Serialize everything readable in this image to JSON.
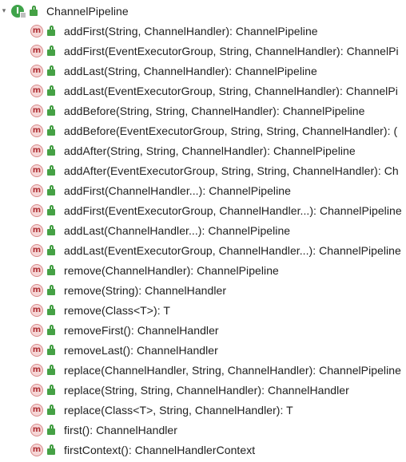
{
  "tree": {
    "root": {
      "icon": "interface-icon",
      "badge_letter": "I",
      "visibility": "lock-icon",
      "label": "ChannelPipeline"
    },
    "method_badge_letter": "m",
    "methods": [
      "addFirst(String, ChannelHandler): ChannelPipeline",
      "addFirst(EventExecutorGroup, String, ChannelHandler): ChannelPi",
      "addLast(String, ChannelHandler): ChannelPipeline",
      "addLast(EventExecutorGroup, String, ChannelHandler): ChannelPi",
      "addBefore(String, String, ChannelHandler): ChannelPipeline",
      "addBefore(EventExecutorGroup, String, String, ChannelHandler): (",
      "addAfter(String, String, ChannelHandler): ChannelPipeline",
      "addAfter(EventExecutorGroup, String, String, ChannelHandler): Ch",
      "addFirst(ChannelHandler...): ChannelPipeline",
      "addFirst(EventExecutorGroup, ChannelHandler...): ChannelPipeline",
      "addLast(ChannelHandler...): ChannelPipeline",
      "addLast(EventExecutorGroup, ChannelHandler...): ChannelPipeline",
      "remove(ChannelHandler): ChannelPipeline",
      "remove(String): ChannelHandler",
      "remove(Class<T>): T",
      "removeFirst(): ChannelHandler",
      "removeLast(): ChannelHandler",
      "replace(ChannelHandler, String, ChannelHandler): ChannelPipeline",
      "replace(String, String, ChannelHandler): ChannelHandler",
      "replace(Class<T>, String, ChannelHandler): T",
      "first(): ChannelHandler",
      "firstContext(): ChannelHandlerContext"
    ],
    "colors": {
      "interface_badge": "#3fa34a",
      "method_badge_bg": "#f6d6d6",
      "method_badge_fg": "#b1363a",
      "lock": "#45a145",
      "text": "#202020"
    }
  }
}
